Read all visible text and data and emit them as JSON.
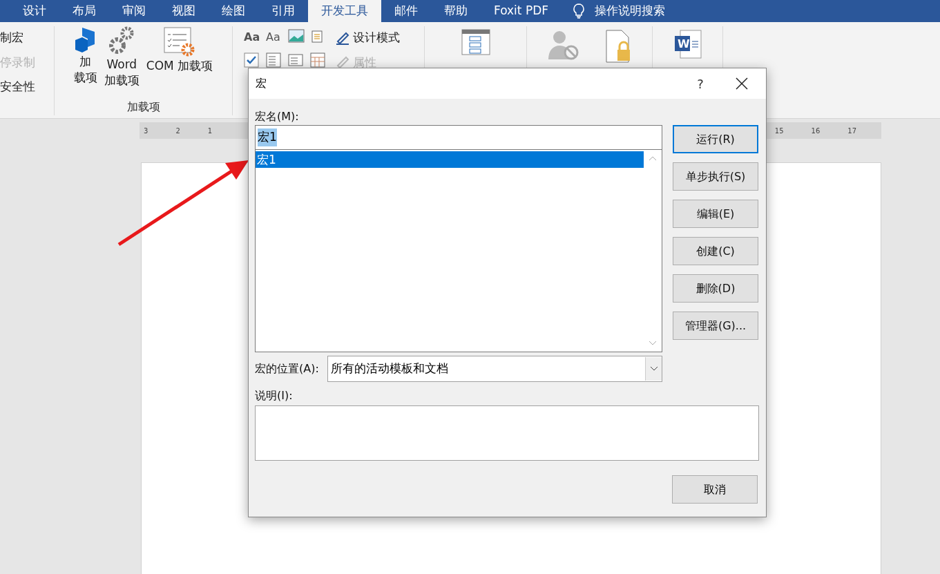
{
  "ribbon_tabs": [
    {
      "label": "设计",
      "selected": false
    },
    {
      "label": "布局",
      "selected": false
    },
    {
      "label": "审阅",
      "selected": false
    },
    {
      "label": "视图",
      "selected": false
    },
    {
      "label": "绘图",
      "selected": false
    },
    {
      "label": "引用",
      "selected": false
    },
    {
      "label": "开发工具",
      "selected": true
    },
    {
      "label": "邮件",
      "selected": false
    },
    {
      "label": "帮助",
      "selected": false
    },
    {
      "label": "Foxit PDF",
      "selected": false
    }
  ],
  "tell_me": {
    "label": "操作说明搜索"
  },
  "code_group": [
    {
      "label": "制宏",
      "disabled": false
    },
    {
      "label": "停录制",
      "disabled": true
    },
    {
      "label": "安全性",
      "disabled": false
    }
  ],
  "addins_group": {
    "title": "加载项",
    "buttons": [
      {
        "kind": "addins",
        "lines": [
          "加",
          "载项"
        ]
      },
      {
        "kind": "word",
        "lines": [
          "Word",
          "加载项"
        ]
      },
      {
        "kind": "com",
        "lines": [
          "COM 加载项"
        ]
      }
    ]
  },
  "control_glyphs": [
    "Aa",
    "Aa"
  ],
  "template_icon_letter": "W",
  "controls_group": [
    {
      "label": "设计模式",
      "disabled": false
    },
    {
      "label": "属性",
      "disabled": true
    }
  ],
  "ruler": {
    "left_labels": [
      "3",
      "2",
      "1"
    ],
    "right_labels": [
      "15",
      "16",
      "17"
    ]
  },
  "dialog": {
    "title": "宏",
    "help": "?",
    "macro_name_label": "宏名(M):",
    "macro_name_value": "宏1",
    "value_selected": true,
    "macros": [
      {
        "name": "宏1",
        "selected": true
      }
    ],
    "buttons": [
      {
        "label": "运行(R)",
        "default": true
      },
      {
        "label": "单步执行(S)",
        "default": false
      },
      {
        "label": "编辑(E)",
        "default": false
      },
      {
        "label": "创建(C)",
        "default": false
      },
      {
        "label": "删除(D)",
        "default": false
      },
      {
        "label": "管理器(G)...",
        "default": false
      }
    ],
    "location_label": "宏的位置(A):",
    "location_value": "所有的活动模板和文档",
    "description_label": "说明(I):",
    "cancel": "取消"
  }
}
